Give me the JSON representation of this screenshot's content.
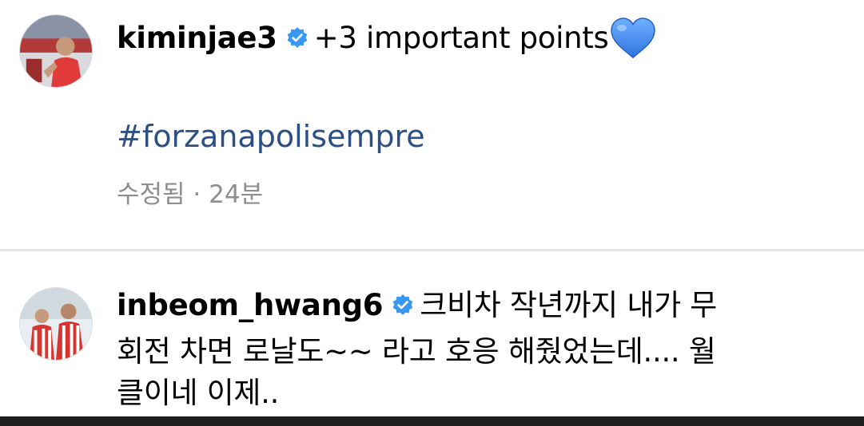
{
  "comments": [
    {
      "username": "kiminjae3",
      "text": "+3 important points",
      "emoji_icon": "blue-heart-icon",
      "hashtag": "#forzanapolisempre",
      "status": "수정됨",
      "separator": "·",
      "time": "24분"
    },
    {
      "username": "inbeom_hwang6",
      "text_line1": "크비차 작년까지 내가 무",
      "text_line2": "회전 차면 로날도~~ 라고 호응 해줬었는데.... 월",
      "text_line3": "클이네 이제.."
    }
  ],
  "icons": {
    "verified": "verified-badge-icon",
    "heart": "blue-heart-icon"
  },
  "colors": {
    "verified_badge": "#3897f0",
    "hashtag": "#2c4f86",
    "meta_text": "#8e8e8e",
    "heart": "#4a8ff0"
  }
}
